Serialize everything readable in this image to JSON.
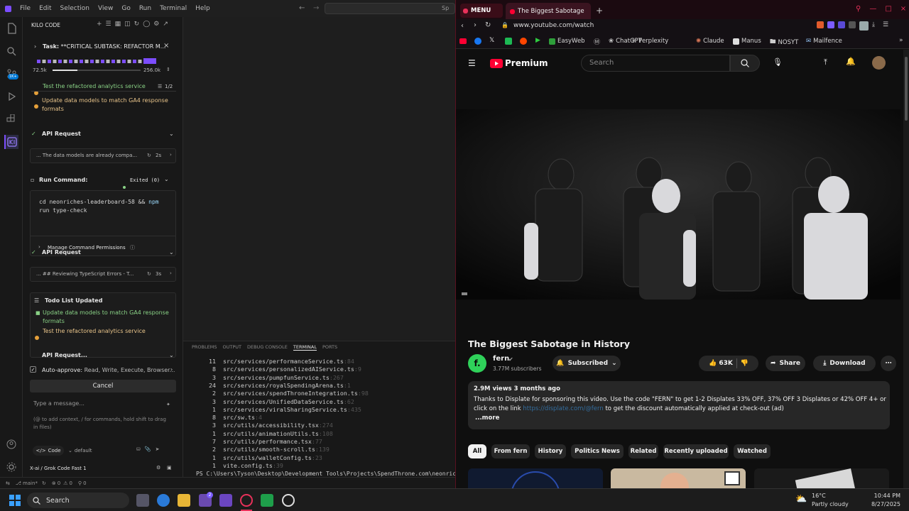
{
  "vscode": {
    "menu": [
      "File",
      "Edit",
      "Selection",
      "View",
      "Go",
      "Run",
      "Terminal",
      "Help"
    ],
    "search_hint": "Sp",
    "panel_title": "KILO CODE",
    "act_badge": "1K+",
    "task_label": "Task:",
    "task_title": "**CRITICAL SUBTASK: REFACTOR M...",
    "tokens_used": "72.5k",
    "tokens_total": "256.0k",
    "tokens_fill": 0.28,
    "todo_current": "Test the refactored analytics service",
    "todo_count": "1/2",
    "todo_item_1": "Update data models to match GA4 response",
    "todo_item_1b": "formats",
    "api_request_1": "API Request",
    "api_1_text": "... The data models are already compa...",
    "api_1_time": "2s",
    "run_command_label": "Run Command:",
    "run_command_status": "Exited (0)",
    "cmd_part1": "cd neonriches-leaderboard-58 &&",
    "cmd_part2": "npm",
    "cmd_part3": "run type-check",
    "manage_perms": "Manage Command Permissions",
    "api_request_2": "API Request",
    "api_2_text": "... ## Reviewing TypeScript Errors - T...",
    "api_2_time": "3s",
    "todo_updated": "Todo List Updated",
    "todo_u1": "Update data models to match GA4 response",
    "todo_u1b": "formats",
    "todo_u2": "Test the refactored analytics service",
    "api_request_3": "API Request...",
    "auto_approve": "Auto-approve:",
    "auto_approve_list": "Read, Write, Execute, Browser...",
    "cancel": "Cancel",
    "input_placeholder": "Type a message...",
    "input_hint": "(@ to add context, / for commands, hold shift to drag in files)",
    "mode": "Code",
    "profile": "default",
    "model": "X-ai / Grok Code Fast 1",
    "panel_tabs": [
      "PROBLEMS",
      "OUTPUT",
      "DEBUG CONSOLE",
      "TERMINAL",
      "PORTS"
    ],
    "terminal_lines": [
      {
        "n": "11",
        "path": "src/services/performanceService.ts",
        "sfx": ":84"
      },
      {
        "n": "8",
        "path": "src/services/personalizedAIService.ts",
        "sfx": ":9"
      },
      {
        "n": "3",
        "path": "src/services/pumpfunService.ts",
        "sfx": ":267"
      },
      {
        "n": "24",
        "path": "src/services/royalSpendingArena.ts",
        "sfx": ":1"
      },
      {
        "n": "2",
        "path": "src/services/spendThroneIntegration.ts",
        "sfx": ":98"
      },
      {
        "n": "3",
        "path": "src/services/UnifiedDataService.ts",
        "sfx": ":62"
      },
      {
        "n": "1",
        "path": "src/services/viralSharingService.ts",
        "sfx": ":435"
      },
      {
        "n": "8",
        "path": "src/sw.ts",
        "sfx": ":4"
      },
      {
        "n": "3",
        "path": "src/utils/accessibility.tsx",
        "sfx": ":274"
      },
      {
        "n": "1",
        "path": "src/utils/animationUtils.ts",
        "sfx": ":108"
      },
      {
        "n": "7",
        "path": "src/utils/performance.tsx",
        "sfx": ":77"
      },
      {
        "n": "2",
        "path": "src/utils/smooth-scroll.ts",
        "sfx": ":139"
      },
      {
        "n": "1",
        "path": "src/utils/walletConfig.ts",
        "sfx": ":23"
      },
      {
        "n": "1",
        "path": "vite.config.ts",
        "sfx": ":39"
      }
    ],
    "prompt": "PS C:\\Users\\Tyson\\Desktop\\Development Tools\\Projects\\SpendThrone.com\\neonriche",
    "status_branch": "main*",
    "status_errors": "0",
    "status_warnings": "0",
    "status_ports": "0"
  },
  "browser": {
    "menu_label": "MENU",
    "tab_title": "The Biggest Sabotage",
    "url": "www.youtube.com/watch",
    "bookmarks": [
      "EasyWeb",
      "ChatGPT",
      "Perplexity",
      "Claude",
      "Manus",
      "NOSYT",
      "Mailfence"
    ],
    "yt_brand": "Premium",
    "search_placeholder": "Search",
    "video_title": "The Biggest Sabotage in History",
    "channel": "fern",
    "channel_initial": "f.",
    "subscribers": "3.77M subscribers",
    "subscribed": "Subscribed",
    "likes": "63K",
    "share": "Share",
    "download": "Download",
    "views_line": "2.9M views  3 months ago",
    "desc_1": "Thanks to Displate for sponsoring this video. Use the code \"FERN\" to get 1-2 Displates 33% OFF, 37% OFF 3 Displates or 42% OFF 4+ or click",
    "desc_2a": "on the link",
    "desc_link": "https://displate.com/@fern",
    "desc_2b": "to get the discount automatically applied at check-out (ad)",
    "more": "...more",
    "chips": [
      "All",
      "From fern",
      "History",
      "Politics News",
      "Related",
      "Recently uploaded",
      "Watched"
    ]
  },
  "taskbar": {
    "search": "Search",
    "temp": "16°C",
    "weather": "Partly cloudy",
    "time": "10:44 PM",
    "date": "8/27/2025",
    "badge": "2"
  },
  "colors": {
    "yt_red": "#ff0033",
    "kilo_accent": "#7c4dff",
    "todo_green": "#89d185",
    "todo_orange": "#e5a03a",
    "browser_accent": "#e8315a"
  }
}
